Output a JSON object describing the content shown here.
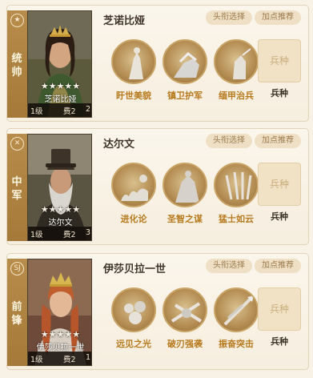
{
  "heroes": [
    {
      "position": "统帅",
      "badge": "★",
      "name": "芝诺比娅",
      "card_name": "芝诺比娅",
      "stars": "★★★★★",
      "level": "1级",
      "cost": "费2",
      "extra": "2",
      "avatar_button": "头衔选择",
      "points_button": "加点推荐",
      "skills": [
        "盱世美貌",
        "镇卫护军",
        "缅甲治兵"
      ],
      "troop_slot": "兵种",
      "troop_label": "兵种",
      "portrait_icon": "queen-portrait"
    },
    {
      "position": "中军",
      "badge": "✕",
      "name": "达尔文",
      "card_name": "达尔文",
      "stars": "★★★★★",
      "level": "1级",
      "cost": "费2",
      "extra": "3",
      "avatar_button": "头衔选择",
      "points_button": "加点推荐",
      "skills": [
        "进化论",
        "圣智之谋",
        "猛士如云"
      ],
      "troop_slot": "兵种",
      "troop_label": "兵种",
      "portrait_icon": "bearded-man-portrait"
    },
    {
      "position": "前锋",
      "badge": "SJ",
      "name": "伊莎贝拉一世",
      "card_name": "伊莎贝拉一世",
      "stars": "★★★★★",
      "level": "1级",
      "cost": "费2",
      "extra": "1",
      "avatar_button": "头衔选择",
      "points_button": "加点推荐",
      "skills": [
        "远见之光",
        "破刃强袭",
        "振奋突击"
      ],
      "troop_slot": "兵种",
      "troop_label": "兵种",
      "portrait_icon": "redhead-queen-portrait"
    }
  ],
  "colors": {
    "side_strip": "#b0854a",
    "skill_text": "#b77a1e",
    "pill_bg": "#efe0c5"
  }
}
